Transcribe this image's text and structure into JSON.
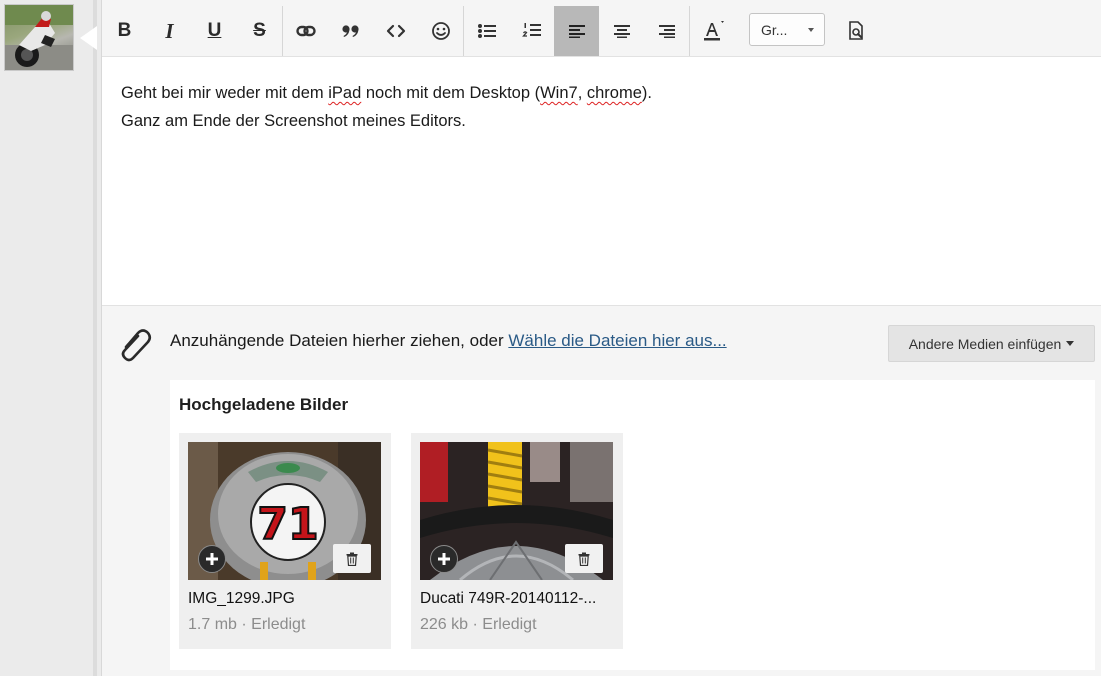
{
  "toolbar": {
    "buttons": [
      {
        "name": "bold",
        "icon": "bold-icon"
      },
      {
        "name": "italic",
        "icon": "italic-icon"
      },
      {
        "name": "underline",
        "icon": "underline-icon"
      },
      {
        "name": "strikethrough",
        "icon": "strikethrough-icon"
      },
      {
        "name": "link",
        "icon": "link-icon"
      },
      {
        "name": "quote",
        "icon": "quote-icon"
      },
      {
        "name": "code",
        "icon": "code-icon"
      },
      {
        "name": "emoji",
        "icon": "smiley-icon"
      },
      {
        "name": "bullet-list",
        "icon": "bullet-list-icon"
      },
      {
        "name": "numbered-list",
        "icon": "numbered-list-icon"
      },
      {
        "name": "align-left",
        "icon": "align-left-icon",
        "active": true
      },
      {
        "name": "align-center",
        "icon": "align-center-icon"
      },
      {
        "name": "align-right",
        "icon": "align-right-icon"
      },
      {
        "name": "font-color",
        "icon": "font-color-icon"
      },
      {
        "name": "preview",
        "icon": "preview-icon"
      }
    ],
    "bold_glyph": "B",
    "italic_glyph": "I",
    "underline_glyph": "U",
    "strike_glyph": "S",
    "font_size_select": {
      "value": "Gr..."
    }
  },
  "editor": {
    "line1_parts": [
      "Geht bei mir weder mit dem ",
      "iPad",
      " noch mit dem Desktop (",
      "Win7",
      ", ",
      "chrome",
      ")."
    ],
    "line2": "Ganz am Ende der Screenshot meines Editors."
  },
  "attachments": {
    "prompt_text": "Anzuhängende Dateien hierher ziehen, oder ",
    "link_text": "Wähle die Dateien hier aus...",
    "media_button": "Andere Medien einfügen",
    "uploaded_title": "Hochgeladene Bilder",
    "files": [
      {
        "name": "IMG_1299.JPG",
        "size": "1.7 mb",
        "status": "Erledigt"
      },
      {
        "name": "Ducati 749R-20140112-...",
        "size": "226 kb",
        "status": "Erledigt"
      }
    ],
    "meta_separator": " · "
  },
  "image_text": {
    "race_number": "71"
  },
  "colors": {
    "link": "#2a5a86",
    "active_toolbar": "#b8b8b8",
    "background": "#f5f5f5"
  }
}
